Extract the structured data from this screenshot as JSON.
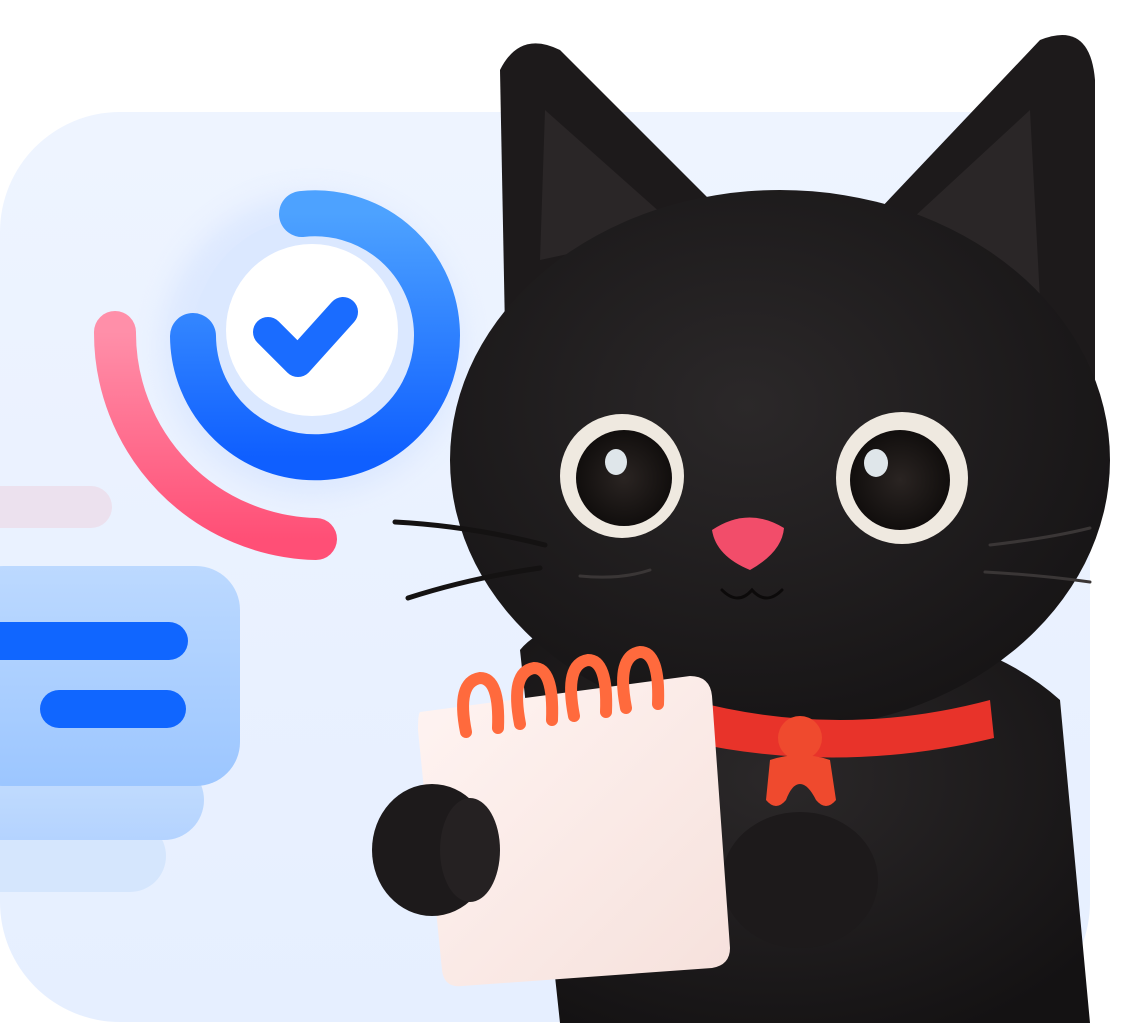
{
  "illustration": {
    "subject": "cat-mascot",
    "props": [
      "notepad",
      "progress-check-badge",
      "chat-bubble"
    ]
  },
  "colors": {
    "background_card": "#ecf3ff",
    "accent_blue": "#1a73ff",
    "accent_blue_light": "#a9d0ff",
    "accent_pink": "#ff5e82",
    "cat_fur": "#1c1a1b",
    "collar": "#e8332a",
    "notepad": "#fbecea",
    "notepad_rings": "#ff6a3d",
    "cat_nose": "#f24d6a",
    "eye_white": "#f2ede6"
  },
  "icons": {
    "check": "check-icon",
    "bubble": "chat-bubble-icon"
  }
}
